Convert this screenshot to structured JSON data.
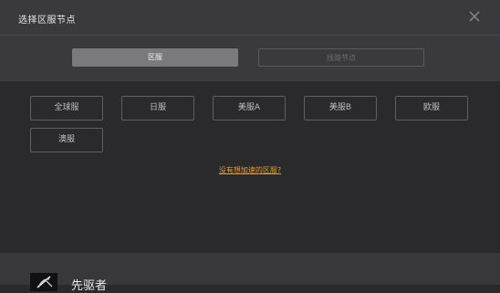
{
  "dialog": {
    "title": "选择区服节点",
    "close_icon": "close-icon"
  },
  "tabs": [
    {
      "label": "区服",
      "active": true
    },
    {
      "label": "线路节点",
      "active": false
    }
  ],
  "servers": [
    {
      "label": "全球服"
    },
    {
      "label": "日服"
    },
    {
      "label": "美服A"
    },
    {
      "label": "美服B"
    },
    {
      "label": "欧服"
    },
    {
      "label": "澳服"
    }
  ],
  "help_link": "没有想加速的区服?",
  "footer": {
    "app_name": "先驱者",
    "logo_icon": "game-logo-icon"
  },
  "colors": {
    "accent_link": "#e0a02a",
    "active_tab": "#7a7a7d",
    "background": "#2a2a2d",
    "header": "#3a3a3d"
  }
}
